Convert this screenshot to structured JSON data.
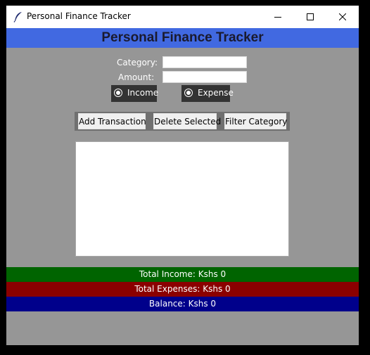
{
  "window": {
    "title": "Personal Finance Tracker",
    "controls": [
      "minimize",
      "maximize",
      "close"
    ]
  },
  "header": {
    "title": "Personal Finance Tracker",
    "background": "#4169e1"
  },
  "form": {
    "category_label": "Category:",
    "category_value": "",
    "amount_label": "Amount:",
    "amount_value": ""
  },
  "type_options": {
    "selected": "none",
    "items": [
      {
        "label": "Income"
      },
      {
        "label": "Expense"
      }
    ]
  },
  "actions": {
    "add_label": "Add Transaction",
    "delete_label": "Delete Selected",
    "filter_label": "Filter Category"
  },
  "transactions": [],
  "summary": {
    "income_text": "Total Income: Kshs 0",
    "expenses_text": "Total Expenses: Kshs 0",
    "balance_text": "Balance: Kshs 0",
    "income_color": "#006400",
    "expenses_color": "#8b0000",
    "balance_color": "#00008b"
  },
  "icons": [
    "feather-icon",
    "minimize-icon",
    "maximize-icon",
    "close-icon",
    "radio-icon"
  ]
}
